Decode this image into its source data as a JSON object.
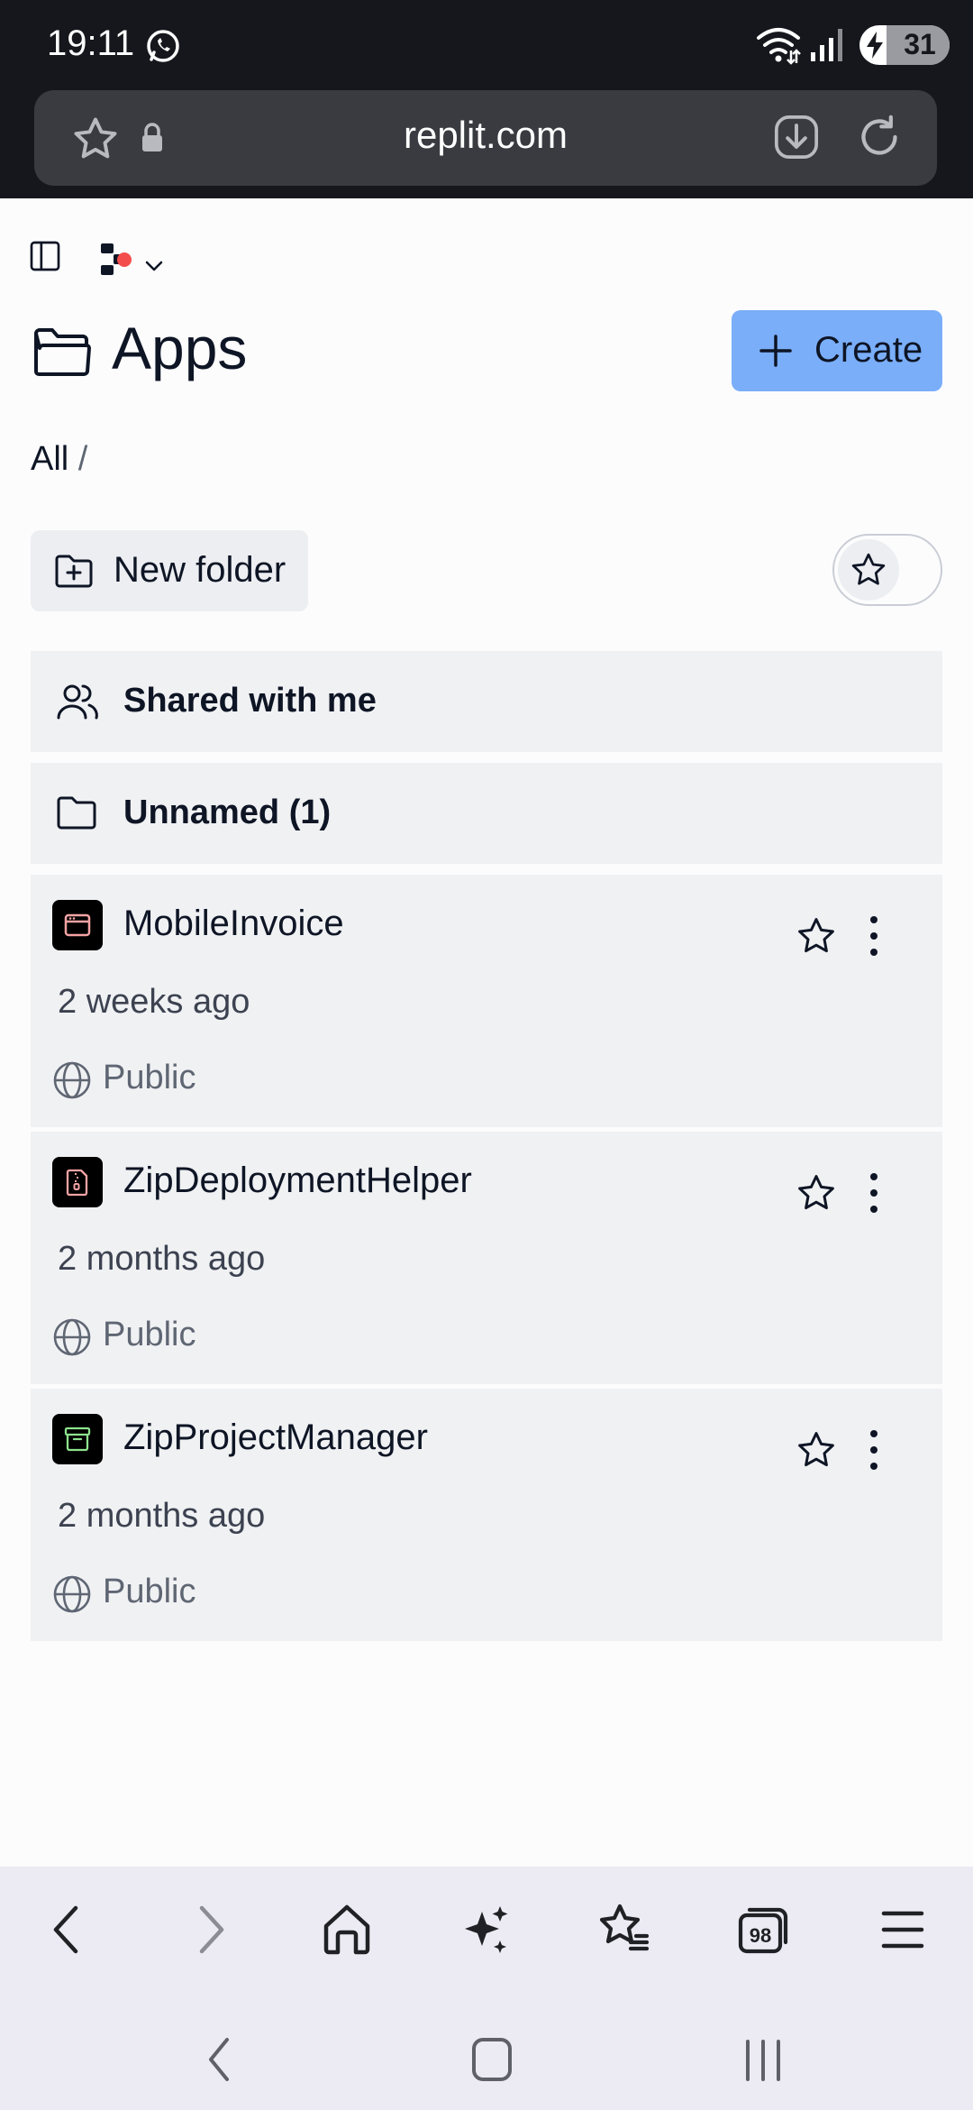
{
  "status_bar": {
    "time": "19:11",
    "battery": "31"
  },
  "browser": {
    "url": "replit.com"
  },
  "page": {
    "title": "Apps",
    "create_label": "Create",
    "breadcrumb_root": "All",
    "breadcrumb_sep": "/",
    "new_folder_label": "New folder"
  },
  "folders": [
    {
      "label": "Shared with me",
      "icon": "users-icon"
    },
    {
      "label": "Unnamed (1)",
      "icon": "folder-icon"
    }
  ],
  "apps": [
    {
      "name": "MobileInvoice",
      "time": "2 weeks ago",
      "visibility": "Public",
      "accent": "#f4a3a3",
      "icon": "browser-window-icon"
    },
    {
      "name": "ZipDeploymentHelper",
      "time": "2 months ago",
      "visibility": "Public",
      "accent": "#f4a3a3",
      "icon": "zip-file-icon"
    },
    {
      "name": "ZipProjectManager",
      "time": "2 months ago",
      "visibility": "Public",
      "accent": "#8de38d",
      "icon": "archive-box-icon"
    }
  ],
  "bottom_nav": {
    "tabs_count": "98"
  },
  "colors": {
    "accent": "#7aaef9",
    "notification": "#f44d4d"
  }
}
